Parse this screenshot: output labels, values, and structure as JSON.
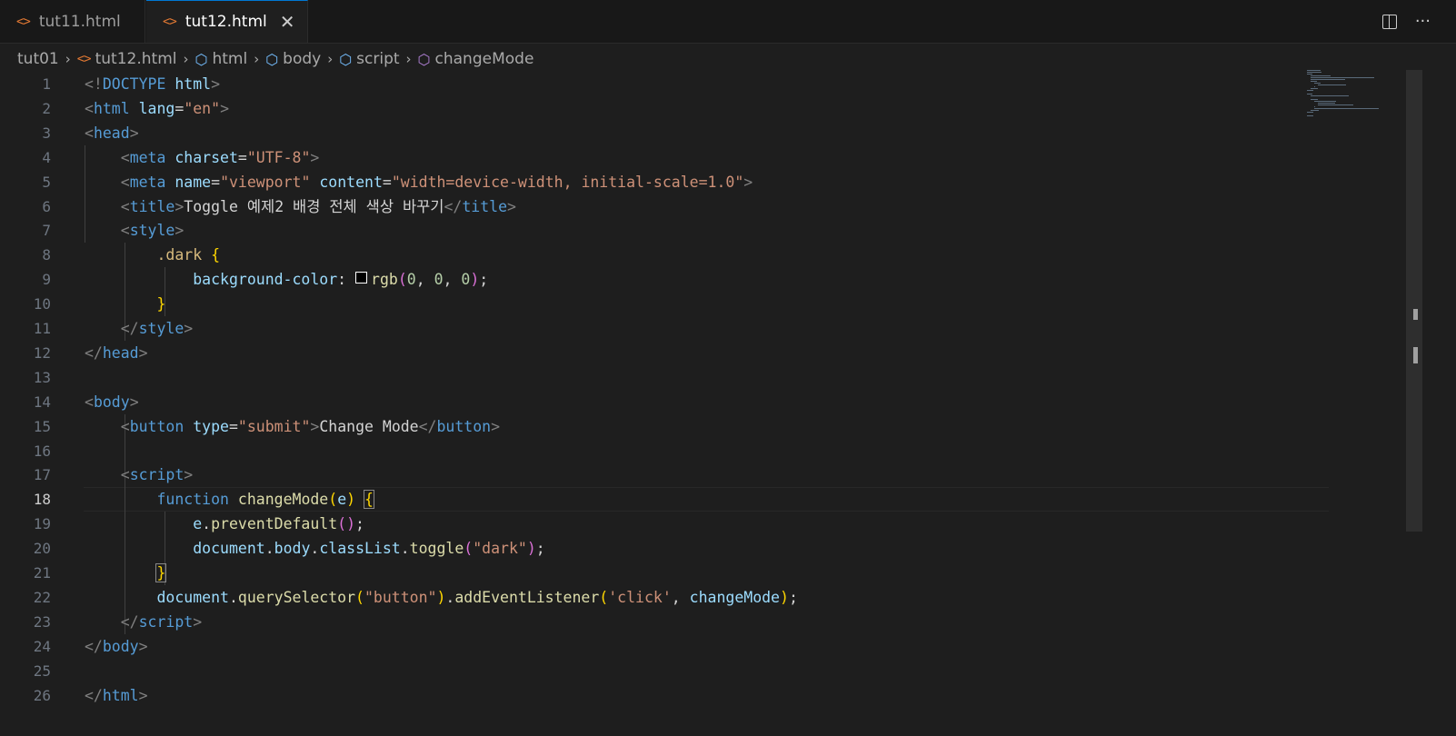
{
  "tabs": [
    {
      "label": "tut11.html",
      "active": false,
      "icon": "html-file-icon"
    },
    {
      "label": "tut12.html",
      "active": true,
      "icon": "html-file-icon"
    }
  ],
  "tab_close_glyph": "✕",
  "tab_icon_glyph": "<>",
  "actions": {
    "more_glyph": "···"
  },
  "breadcrumb": {
    "items": [
      "tut01",
      "tut12.html",
      "html",
      "body",
      "script",
      "changeMode"
    ],
    "separator": "›"
  },
  "editor": {
    "current_line": 18,
    "lines": [
      {
        "n": "1",
        "tokens": [
          [
            "t-br",
            "<!"
          ],
          [
            "t-tag",
            "DOCTYPE"
          ],
          [
            "t-txt",
            " "
          ],
          [
            "t-attr",
            "html"
          ],
          [
            "t-br",
            ">"
          ]
        ]
      },
      {
        "n": "2",
        "tokens": [
          [
            "t-br",
            "<"
          ],
          [
            "t-tag",
            "html"
          ],
          [
            "t-txt",
            " "
          ],
          [
            "t-attr",
            "lang"
          ],
          [
            "t-txt",
            "="
          ],
          [
            "t-str",
            "\"en\""
          ],
          [
            "t-br",
            ">"
          ]
        ]
      },
      {
        "n": "3",
        "tokens": [
          [
            "t-br",
            "<"
          ],
          [
            "t-tag",
            "head"
          ],
          [
            "t-br",
            ">"
          ]
        ]
      },
      {
        "n": "4",
        "tokens": [
          [
            "t-txt",
            "    "
          ],
          [
            "t-br",
            "<"
          ],
          [
            "t-tag",
            "meta"
          ],
          [
            "t-txt",
            " "
          ],
          [
            "t-attr",
            "charset"
          ],
          [
            "t-txt",
            "="
          ],
          [
            "t-str",
            "\"UTF-8\""
          ],
          [
            "t-br",
            ">"
          ]
        ]
      },
      {
        "n": "5",
        "tokens": [
          [
            "t-txt",
            "    "
          ],
          [
            "t-br",
            "<"
          ],
          [
            "t-tag",
            "meta"
          ],
          [
            "t-txt",
            " "
          ],
          [
            "t-attr",
            "name"
          ],
          [
            "t-txt",
            "="
          ],
          [
            "t-str",
            "\"viewport\""
          ],
          [
            "t-txt",
            " "
          ],
          [
            "t-attr",
            "content"
          ],
          [
            "t-txt",
            "="
          ],
          [
            "t-str",
            "\"width=device-width, initial-scale=1.0\""
          ],
          [
            "t-br",
            ">"
          ]
        ]
      },
      {
        "n": "6",
        "tokens": [
          [
            "t-txt",
            "    "
          ],
          [
            "t-br",
            "<"
          ],
          [
            "t-tag",
            "title"
          ],
          [
            "t-br",
            ">"
          ],
          [
            "t-txt",
            "Toggle 예제2 배경 전체 색상 바꾸기"
          ],
          [
            "t-br",
            "</"
          ],
          [
            "t-tag",
            "title"
          ],
          [
            "t-br",
            ">"
          ]
        ]
      },
      {
        "n": "7",
        "tokens": [
          [
            "t-txt",
            "    "
          ],
          [
            "t-br",
            "<"
          ],
          [
            "t-tag",
            "style"
          ],
          [
            "t-br",
            ">"
          ]
        ]
      },
      {
        "n": "8",
        "tokens": [
          [
            "t-txt",
            "        "
          ],
          [
            "t-sel",
            ".dark"
          ],
          [
            "t-txt",
            " "
          ],
          [
            "t-b1",
            "{"
          ]
        ]
      },
      {
        "n": "9",
        "tokens": [
          [
            "t-txt",
            "            "
          ],
          [
            "t-prop",
            "background-color"
          ],
          [
            "t-txt",
            ": "
          ],
          [
            "swatch",
            ""
          ],
          [
            "t-fn",
            "rgb"
          ],
          [
            "t-b2",
            "("
          ],
          [
            "t-num",
            "0"
          ],
          [
            "t-txt",
            ", "
          ],
          [
            "t-num",
            "0"
          ],
          [
            "t-txt",
            ", "
          ],
          [
            "t-num",
            "0"
          ],
          [
            "t-b2",
            ")"
          ],
          [
            "t-txt",
            ";"
          ]
        ]
      },
      {
        "n": "10",
        "tokens": [
          [
            "t-txt",
            "        "
          ],
          [
            "t-b1",
            "}"
          ]
        ]
      },
      {
        "n": "11",
        "tokens": [
          [
            "t-txt",
            "    "
          ],
          [
            "t-br",
            "</"
          ],
          [
            "t-tag",
            "style"
          ],
          [
            "t-br",
            ">"
          ]
        ]
      },
      {
        "n": "12",
        "tokens": [
          [
            "t-br",
            "</"
          ],
          [
            "t-tag",
            "head"
          ],
          [
            "t-br",
            ">"
          ]
        ]
      },
      {
        "n": "13",
        "tokens": []
      },
      {
        "n": "14",
        "tokens": [
          [
            "t-br",
            "<"
          ],
          [
            "t-tag",
            "body"
          ],
          [
            "t-br",
            ">"
          ]
        ]
      },
      {
        "n": "15",
        "tokens": [
          [
            "t-txt",
            "    "
          ],
          [
            "t-br",
            "<"
          ],
          [
            "t-tag",
            "button"
          ],
          [
            "t-txt",
            " "
          ],
          [
            "t-attr",
            "type"
          ],
          [
            "t-txt",
            "="
          ],
          [
            "t-str",
            "\"submit\""
          ],
          [
            "t-br",
            ">"
          ],
          [
            "t-txt",
            "Change Mode"
          ],
          [
            "t-br",
            "</"
          ],
          [
            "t-tag",
            "button"
          ],
          [
            "t-br",
            ">"
          ]
        ]
      },
      {
        "n": "16",
        "tokens": []
      },
      {
        "n": "17",
        "tokens": [
          [
            "t-txt",
            "    "
          ],
          [
            "t-br",
            "<"
          ],
          [
            "t-tag",
            "script"
          ],
          [
            "t-br",
            ">"
          ]
        ]
      },
      {
        "n": "18",
        "tokens": [
          [
            "t-txt",
            "        "
          ],
          [
            "t-kw",
            "function"
          ],
          [
            "t-txt",
            " "
          ],
          [
            "t-fn",
            "changeMode"
          ],
          [
            "t-b1",
            "("
          ],
          [
            "t-var",
            "e"
          ],
          [
            "t-b1",
            ")"
          ],
          [
            "t-txt",
            " "
          ],
          [
            "t-b1 bracket-match",
            "{"
          ]
        ]
      },
      {
        "n": "19",
        "tokens": [
          [
            "t-txt",
            "            "
          ],
          [
            "t-var",
            "e"
          ],
          [
            "t-txt",
            "."
          ],
          [
            "t-fn",
            "preventDefault"
          ],
          [
            "t-b2",
            "()"
          ],
          [
            "t-txt",
            ";"
          ]
        ]
      },
      {
        "n": "20",
        "tokens": [
          [
            "t-txt",
            "            "
          ],
          [
            "t-var",
            "document"
          ],
          [
            "t-txt",
            "."
          ],
          [
            "t-var",
            "body"
          ],
          [
            "t-txt",
            "."
          ],
          [
            "t-var",
            "classList"
          ],
          [
            "t-txt",
            "."
          ],
          [
            "t-fn",
            "toggle"
          ],
          [
            "t-b2",
            "("
          ],
          [
            "t-str",
            "\"dark\""
          ],
          [
            "t-b2",
            ")"
          ],
          [
            "t-txt",
            ";"
          ]
        ]
      },
      {
        "n": "21",
        "tokens": [
          [
            "t-txt",
            "        "
          ],
          [
            "t-b1 bracket-match",
            "}"
          ]
        ]
      },
      {
        "n": "22",
        "tokens": [
          [
            "t-txt",
            "        "
          ],
          [
            "t-var",
            "document"
          ],
          [
            "t-txt",
            "."
          ],
          [
            "t-fn",
            "querySelector"
          ],
          [
            "t-b1",
            "("
          ],
          [
            "t-str",
            "\"button\""
          ],
          [
            "t-b1",
            ")"
          ],
          [
            "t-txt",
            "."
          ],
          [
            "t-fn",
            "addEventListener"
          ],
          [
            "t-b1",
            "("
          ],
          [
            "t-str",
            "'click'"
          ],
          [
            "t-txt",
            ", "
          ],
          [
            "t-var",
            "changeMode"
          ],
          [
            "t-b1",
            ")"
          ],
          [
            "t-txt",
            ";"
          ]
        ]
      },
      {
        "n": "23",
        "tokens": [
          [
            "t-txt",
            "    "
          ],
          [
            "t-br",
            "</"
          ],
          [
            "t-tag",
            "script"
          ],
          [
            "t-br",
            ">"
          ]
        ]
      },
      {
        "n": "24",
        "tokens": [
          [
            "t-br",
            "</"
          ],
          [
            "t-tag",
            "body"
          ],
          [
            "t-br",
            ">"
          ]
        ]
      },
      {
        "n": "25",
        "tokens": []
      },
      {
        "n": "26",
        "tokens": [
          [
            "t-br",
            "</"
          ],
          [
            "t-tag",
            "html"
          ],
          [
            "t-br",
            ">"
          ]
        ]
      }
    ]
  }
}
